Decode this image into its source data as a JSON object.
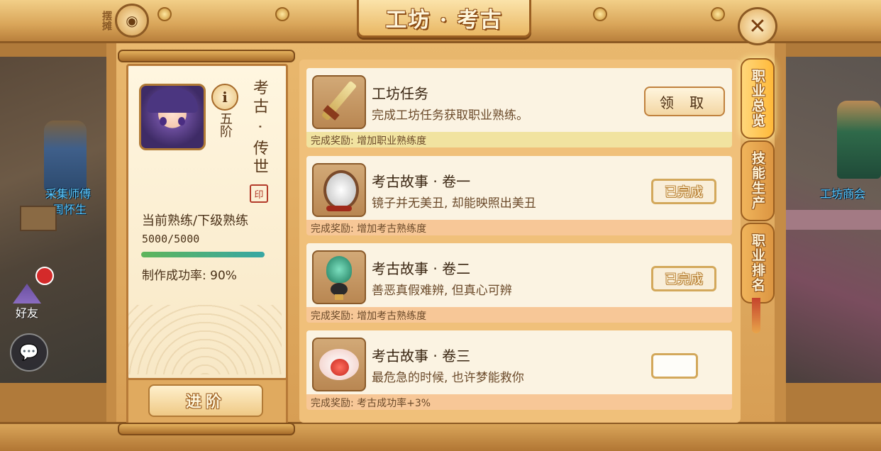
{
  "header": {
    "title": "工坊 · 考古",
    "stall_label": "摆摊",
    "stall_icon": "stall-icon",
    "close_icon": "close-icon"
  },
  "profile": {
    "rank": "五阶",
    "title_vertical": "考古 · 传世",
    "proficiency_label": "当前熟练/下级熟练",
    "proficiency_value": "5000/5000",
    "proficiency_fraction": 1.0,
    "success_rate": "制作成功率: 90%",
    "advance_label": "进阶",
    "info_icon": "i"
  },
  "tasks": [
    {
      "title": "工坊任务",
      "desc": "完成工坊任务获取职业熟练。",
      "reward": "完成奖励: 增加职业熟练度",
      "action": "领 取",
      "state": "claimable",
      "icon": "dagger-icon"
    },
    {
      "title": "考古故事 · 卷一",
      "desc": "镜子并无美丑, 却能映照出美丑",
      "reward": "完成奖励: 增加考古熟练度",
      "action": "已完成",
      "state": "done",
      "icon": "mirror-icon"
    },
    {
      "title": "考古故事 · 卷二",
      "desc": "善恶真假难辨, 但真心可辨",
      "reward": "完成奖励: 增加考古熟练度",
      "action": "已完成",
      "state": "done",
      "icon": "jade-ornament-icon"
    },
    {
      "title": "考古故事 · 卷三",
      "desc": "最危急的时候, 也许梦能救你",
      "reward": "完成奖励: 考古成功率+3%",
      "action": "",
      "state": "partial",
      "icon": "dream-cloud-icon"
    }
  ],
  "tabs": [
    {
      "label": "职业总览",
      "active": true
    },
    {
      "label": "技能生产",
      "active": false
    },
    {
      "label": "职业排名",
      "active": false
    }
  ],
  "world": {
    "npc_left_name": "采集师傅",
    "npc_left_name2": "周怀生",
    "npc_right_name": "工坊商会",
    "friends_label": "好友",
    "chat_icon": "chat-icon"
  },
  "colors": {
    "frame": "#d9a559",
    "progress_start": "#5fb55a",
    "progress_end": "#37a7a4",
    "reward_highlight": "#f1e3a0",
    "reward_default": "#f7c797"
  }
}
